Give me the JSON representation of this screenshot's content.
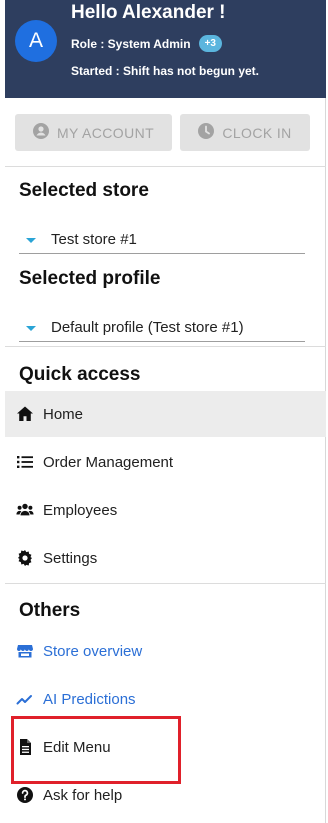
{
  "user": {
    "avatar_initial": "A",
    "greeting": "Hello Alexander !",
    "role": "Role : System Admin",
    "role_badge": "+3",
    "shift_status": "Started : Shift has not begun yet."
  },
  "buttons": {
    "my_account": "MY ACCOUNT",
    "clock_in": "CLOCK IN"
  },
  "store": {
    "title": "Selected store",
    "value": "Test store #1"
  },
  "profile": {
    "title": "Selected profile",
    "value": "Default profile (Test store #1)"
  },
  "quick_access": {
    "title": "Quick access",
    "items": [
      {
        "label": "Home",
        "icon": "home-icon"
      },
      {
        "label": "Order Management",
        "icon": "list-icon"
      },
      {
        "label": "Employees",
        "icon": "users-icon"
      },
      {
        "label": "Settings",
        "icon": "gear-icon"
      }
    ]
  },
  "others": {
    "title": "Others",
    "items": [
      {
        "label": "Store overview",
        "icon": "store-icon"
      },
      {
        "label": "AI Predictions",
        "icon": "trend-icon"
      },
      {
        "label": "Edit Menu",
        "icon": "document-icon"
      },
      {
        "label": "Ask for help",
        "icon": "question-icon"
      }
    ]
  },
  "colors": {
    "header_bg": "#2e3e5f",
    "avatar_bg": "#1f6fe0",
    "badge_bg": "#5bb5de",
    "link": "#2b6fd6",
    "highlight": "#e0202a"
  }
}
